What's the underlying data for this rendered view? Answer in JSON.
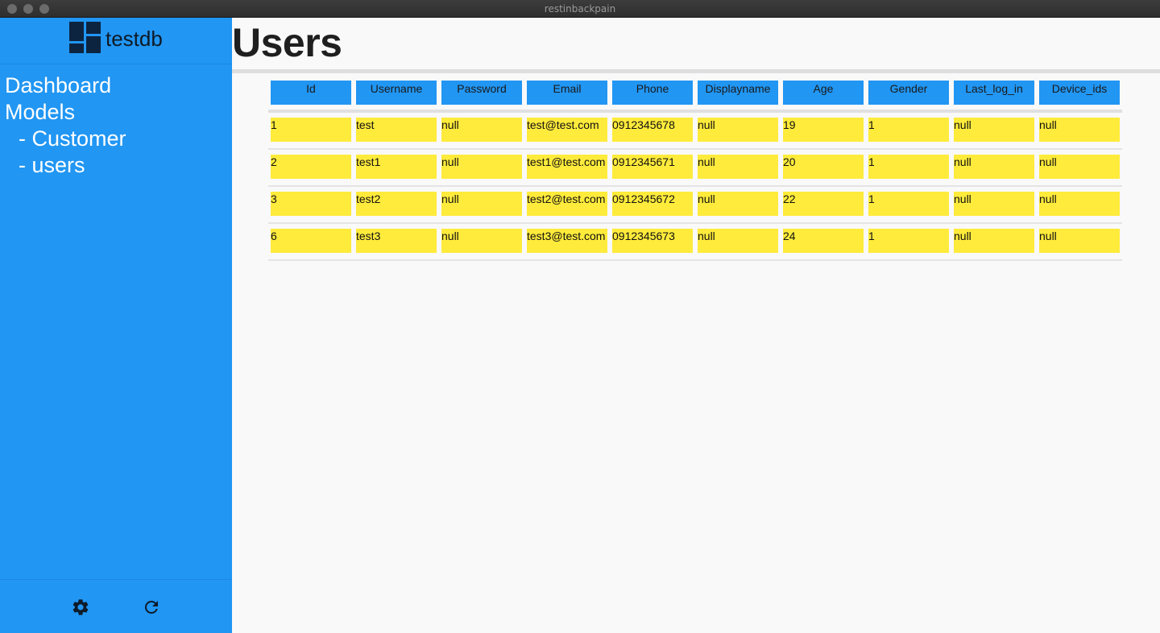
{
  "window": {
    "title": "restinbackpain"
  },
  "sidebar": {
    "brand": "testdb",
    "nav": {
      "dashboard": "Dashboard",
      "models": "Models",
      "customer": "- Customer",
      "users": "- users"
    },
    "footer_icons": [
      "gear-icon",
      "refresh-icon"
    ]
  },
  "main": {
    "title": "Users",
    "table": {
      "headers": [
        "Id",
        "Username",
        "Password",
        "Email",
        "Phone",
        "Displayname",
        "Age",
        "Gender",
        "Last_log_in",
        "Device_ids"
      ],
      "rows": [
        [
          "1",
          "test",
          "null",
          "test@test.com",
          "0912345678",
          "null",
          "19",
          "1",
          "null",
          "null"
        ],
        [
          "2",
          "test1",
          "null",
          "test1@test.com",
          "0912345671",
          "null",
          "20",
          "1",
          "null",
          "null"
        ],
        [
          "3",
          "test2",
          "null",
          "test2@test.com",
          "0912345672",
          "null",
          "22",
          "1",
          "null",
          "null"
        ],
        [
          "6",
          "test3",
          "null",
          "test3@test.com",
          "0912345673",
          "null",
          "24",
          "1",
          "null",
          "null"
        ]
      ]
    }
  },
  "colors": {
    "sidebar": "#2196f3",
    "header_cell": "#2196f3",
    "data_cell": "#ffeb3b",
    "background": "#f9f9f9"
  }
}
